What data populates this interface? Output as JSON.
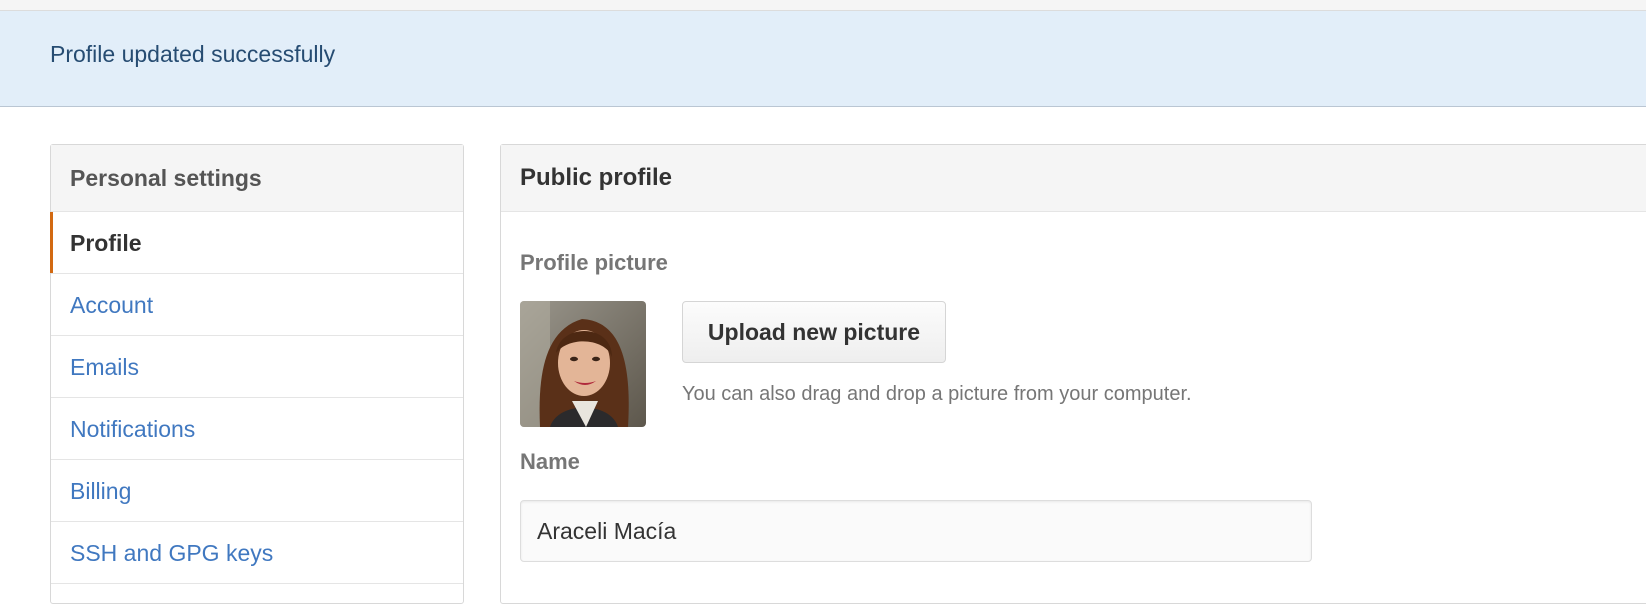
{
  "flash": {
    "message": "Profile updated successfully"
  },
  "sidebar": {
    "title": "Personal settings",
    "items": [
      {
        "label": "Profile",
        "selected": true
      },
      {
        "label": "Account"
      },
      {
        "label": "Emails"
      },
      {
        "label": "Notifications"
      },
      {
        "label": "Billing"
      },
      {
        "label": "SSH and GPG keys"
      }
    ]
  },
  "panel": {
    "title": "Public profile",
    "picture_label": "Profile picture",
    "upload_label": "Upload new picture",
    "drag_hint": "You can also drag and drop a picture from your computer.",
    "name_label": "Name",
    "name_value": "Araceli Macía"
  },
  "colors": {
    "flash_bg": "#e2eef9",
    "link": "#4078c0",
    "selected_accent": "#d26911"
  }
}
